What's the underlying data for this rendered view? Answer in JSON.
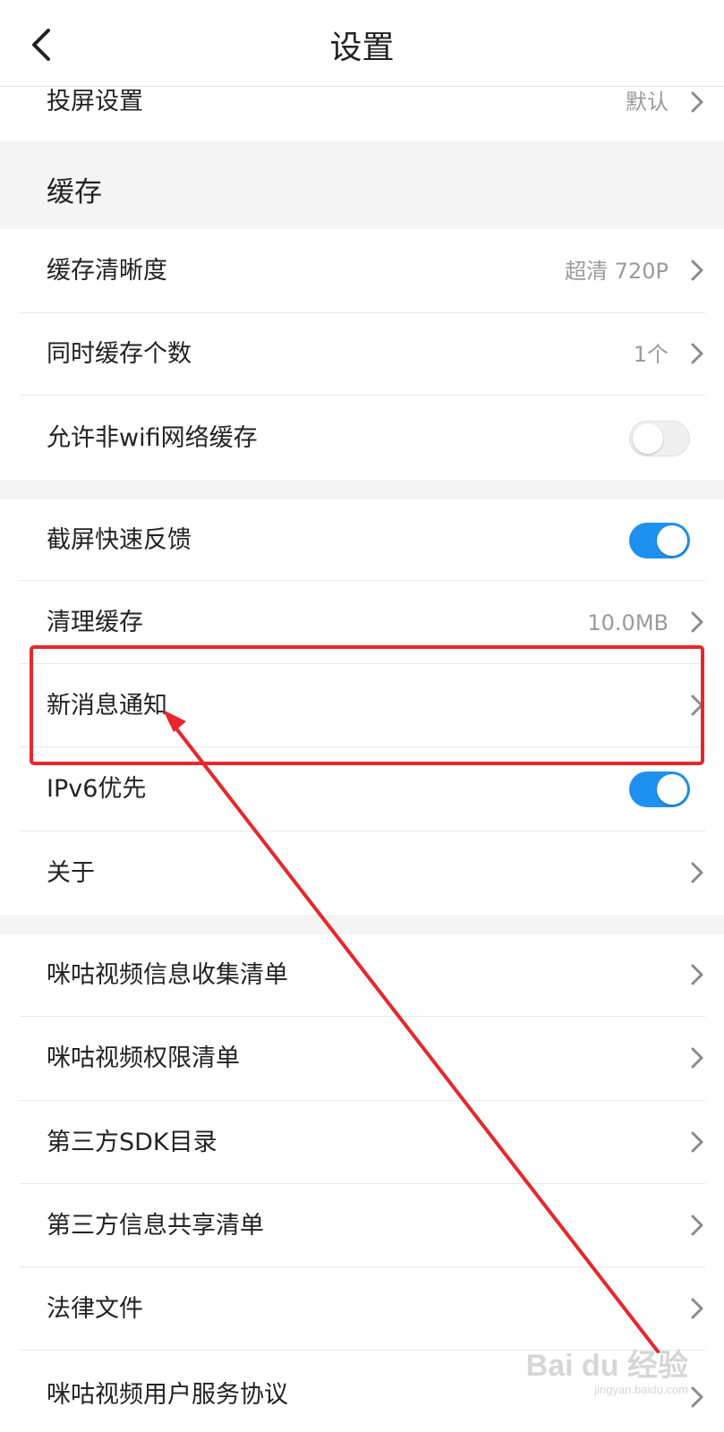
{
  "header": {
    "title": "设置",
    "back_icon": "chevron-left-icon"
  },
  "rows": {
    "cast": {
      "label": "投屏设置",
      "value": "默认"
    },
    "cache_quality": {
      "label": "缓存清晰度",
      "value": "超清 720P"
    },
    "concurrent_cache": {
      "label": "同时缓存个数",
      "value": "1个"
    },
    "non_wifi_cache": {
      "label": "允许非wifi网络缓存",
      "toggle": "off"
    },
    "screenshot_feedback": {
      "label": "截屏快速反馈",
      "toggle": "on"
    },
    "clear_cache": {
      "label": "清理缓存",
      "value": "10.0MB"
    },
    "notifications": {
      "label": "新消息通知"
    },
    "ipv6": {
      "label": "IPv6优先",
      "toggle": "on"
    },
    "about": {
      "label": "关于"
    },
    "info_collection": {
      "label": "咪咕视频信息收集清单"
    },
    "permissions": {
      "label": "咪咕视频权限清单"
    },
    "sdk_directory": {
      "label": "第三方SDK目录"
    },
    "info_sharing": {
      "label": "第三方信息共享清单"
    },
    "legal": {
      "label": "法律文件"
    },
    "user_agreement": {
      "label": "咪咕视频用户服务协议"
    }
  },
  "sections": {
    "cache": "缓存"
  },
  "annotation": {
    "highlight_color": "#e8262b",
    "arrow_color": "#e8262b"
  },
  "watermark": {
    "brand": "Bai du 经验",
    "url": "jingyan.baidu.com"
  },
  "colors": {
    "toggle_on": "#1e90f0",
    "section_bg": "#f4f4f4"
  }
}
